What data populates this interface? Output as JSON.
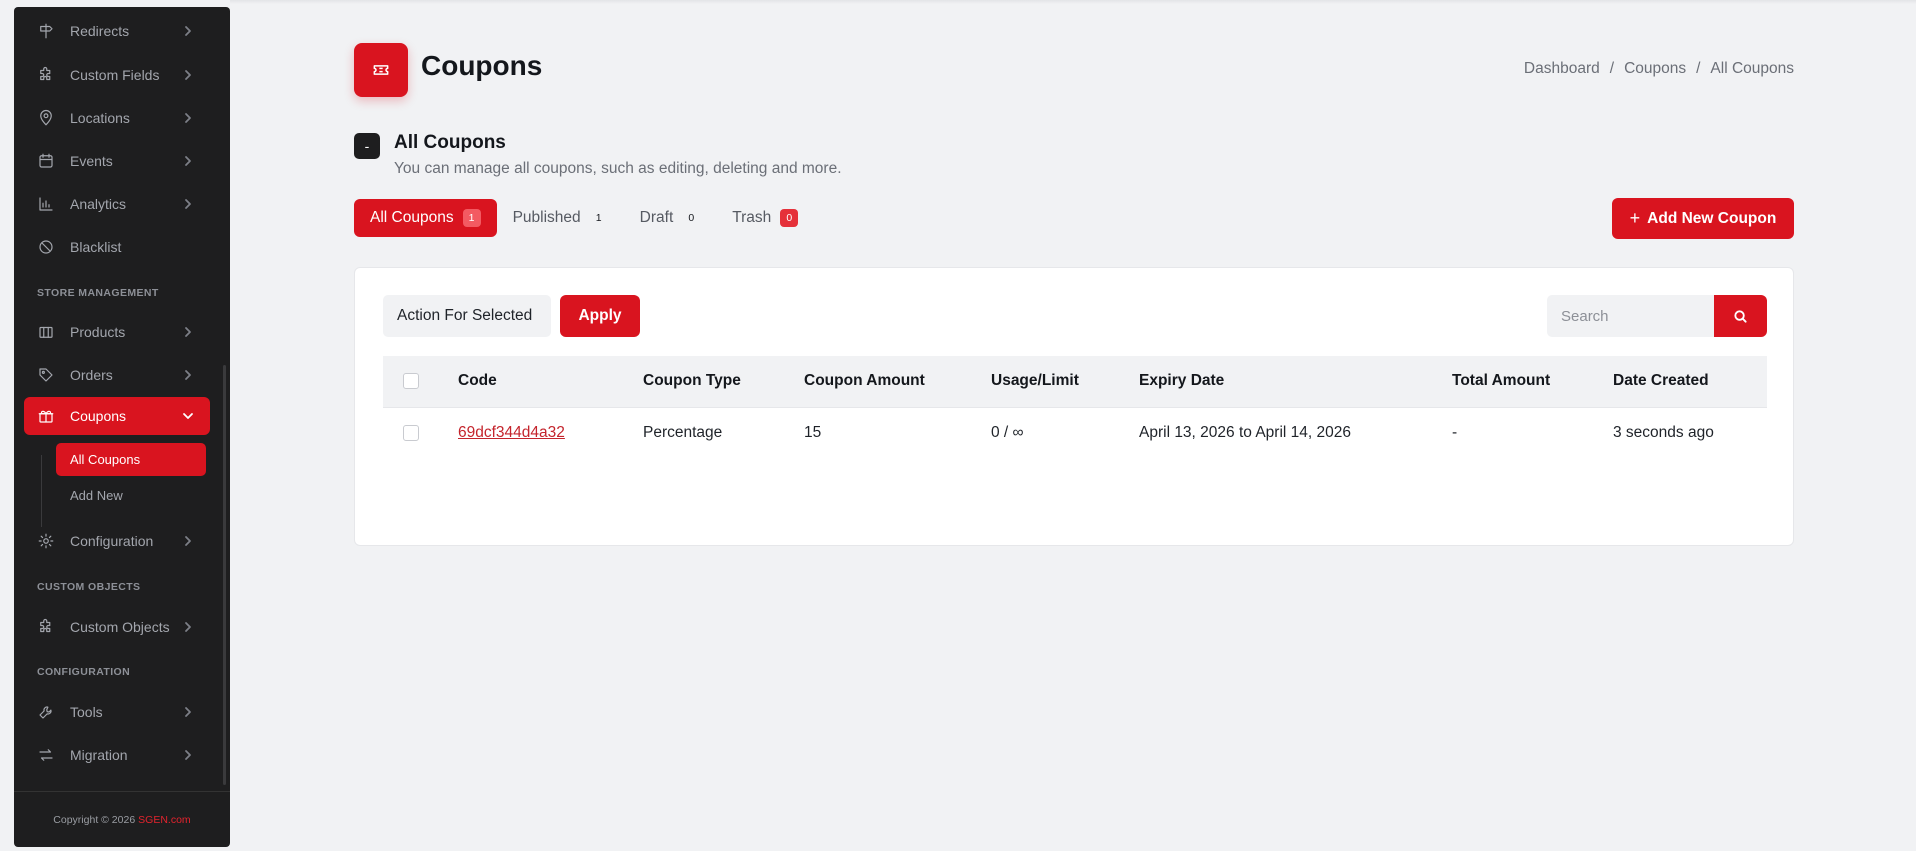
{
  "sidebar": {
    "items_top": [
      {
        "label": "Redirects",
        "icon": "signpost-icon"
      },
      {
        "label": "Custom Fields",
        "icon": "puzzle-icon"
      },
      {
        "label": "Locations",
        "icon": "map-pin-icon"
      },
      {
        "label": "Events",
        "icon": "calendar-icon"
      },
      {
        "label": "Analytics",
        "icon": "bar-chart-icon"
      },
      {
        "label": "Blacklist",
        "icon": "ban-icon"
      }
    ],
    "section_store": "STORE MANAGEMENT",
    "items_store": [
      {
        "label": "Products",
        "icon": "box-icon"
      },
      {
        "label": "Orders",
        "icon": "tag-icon"
      },
      {
        "label": "Coupons",
        "icon": "gift-icon"
      }
    ],
    "coupons_sub": [
      {
        "label": "All Coupons"
      },
      {
        "label": "Add New"
      }
    ],
    "config_item": {
      "label": "Configuration",
      "icon": "gear-icon"
    },
    "section_custom": "CUSTOM OBJECTS",
    "custom_item": {
      "label": "Custom Objects",
      "icon": "puzzle-icon"
    },
    "section_config": "CONFIGURATION",
    "items_config": [
      {
        "label": "Tools",
        "icon": "wrench-icon"
      },
      {
        "label": "Migration",
        "icon": "arrows-icon"
      }
    ],
    "footer_text": "Copyright © 2026",
    "footer_brand": "SGEN.com"
  },
  "header": {
    "title": "Coupons",
    "breadcrumb": [
      "Dashboard",
      "Coupons",
      "All Coupons"
    ],
    "separator": "/",
    "subtitle": "All Coupons",
    "sub_icon_glyph": "-",
    "description": "You can manage all coupons, such as editing, deleting and more."
  },
  "tabs": [
    {
      "label": "All Coupons",
      "count": "1"
    },
    {
      "label": "Published",
      "count": "1"
    },
    {
      "label": "Draft",
      "count": "0"
    },
    {
      "label": "Trash",
      "count": "0"
    }
  ],
  "add_button": {
    "plus": "+",
    "label": "Add New Coupon"
  },
  "toolbar": {
    "action_label": "Action For Selected",
    "apply_label": "Apply",
    "search_placeholder": "Search"
  },
  "table": {
    "columns": [
      "Code",
      "Coupon Type",
      "Coupon Amount",
      "Usage/Limit",
      "Expiry Date",
      "Total Amount",
      "Date Created"
    ],
    "rows": [
      {
        "code": "69dcf344d4a32",
        "type": "Percentage",
        "amount": "15",
        "usage": "0 / ∞",
        "expiry": "April 13, 2026 to April 14, 2026",
        "total": "-",
        "created": "3 seconds ago"
      }
    ]
  },
  "colors": {
    "accent": "#d9141f",
    "sidebar_bg": "#1e1e1f",
    "page_bg": "#f1f2f4"
  }
}
